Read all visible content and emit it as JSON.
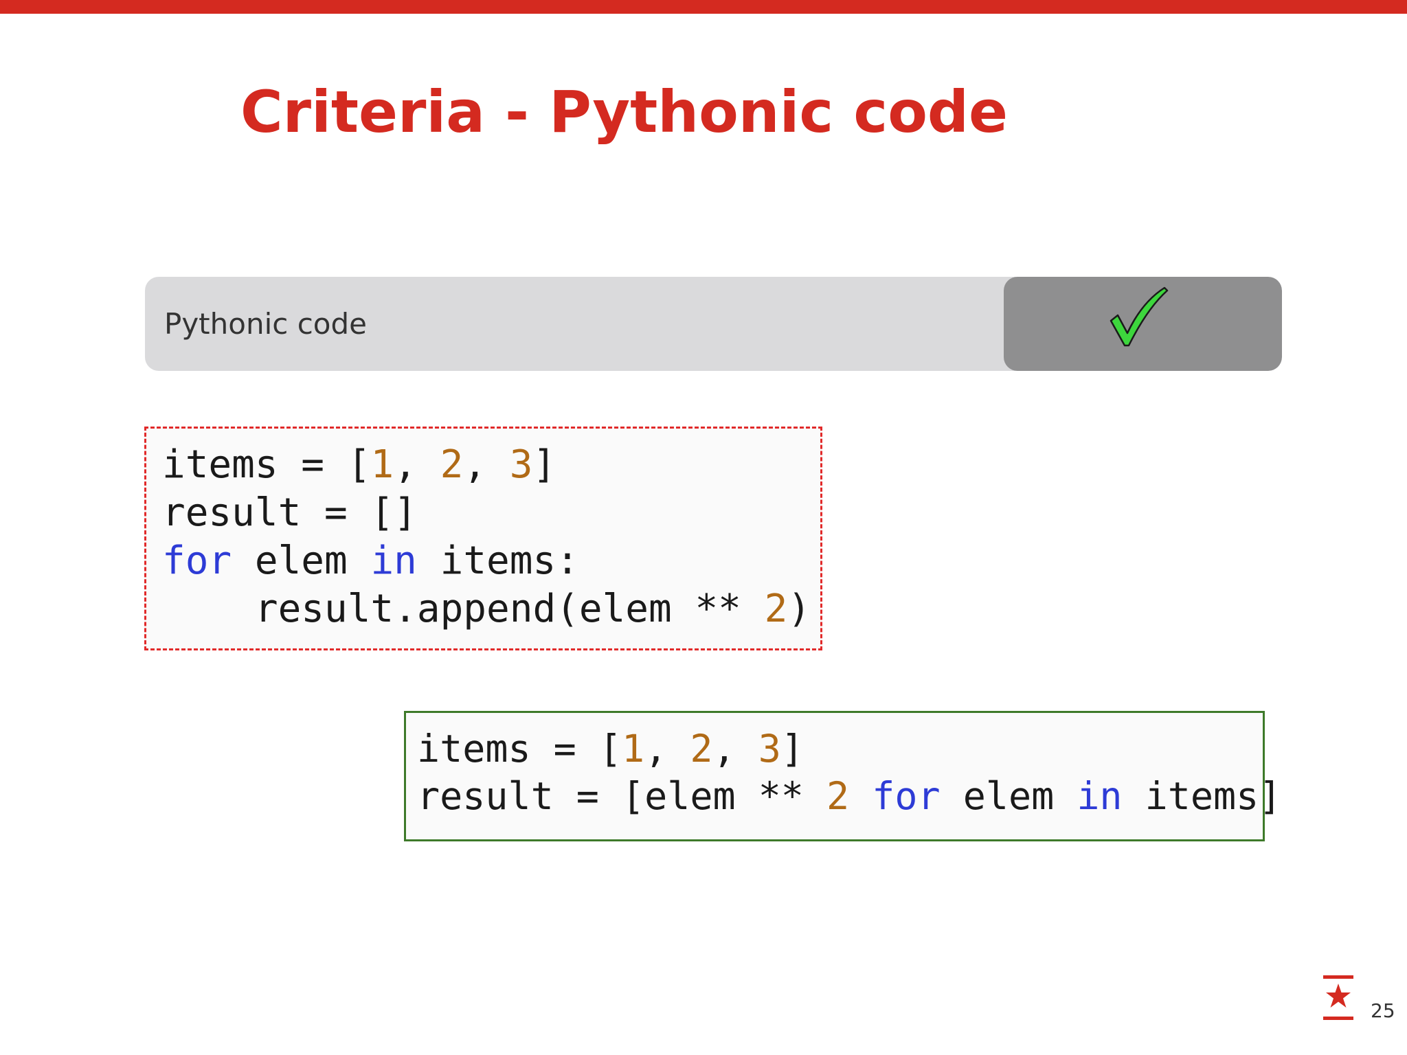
{
  "slide": {
    "title": "Criteria - Pythonic code",
    "page_number": "25"
  },
  "criteria": {
    "label": "Pythonic code",
    "status_icon": "check-icon",
    "status": "checked"
  },
  "code_bad": {
    "lines": [
      [
        {
          "t": "items = [",
          "k": "plain"
        },
        {
          "t": "1",
          "k": "num"
        },
        {
          "t": ", ",
          "k": "plain"
        },
        {
          "t": "2",
          "k": "num"
        },
        {
          "t": ", ",
          "k": "plain"
        },
        {
          "t": "3",
          "k": "num"
        },
        {
          "t": "]",
          "k": "plain"
        }
      ],
      [
        {
          "t": "result = []",
          "k": "plain"
        }
      ],
      [
        {
          "t": "for",
          "k": "kw"
        },
        {
          "t": " elem ",
          "k": "plain"
        },
        {
          "t": "in",
          "k": "kw"
        },
        {
          "t": " items:",
          "k": "plain"
        }
      ],
      [
        {
          "t": "    result.append(elem ** ",
          "k": "plain"
        },
        {
          "t": "2",
          "k": "num"
        },
        {
          "t": ")",
          "k": "plain"
        }
      ]
    ]
  },
  "code_good": {
    "lines": [
      [
        {
          "t": "items = [",
          "k": "plain"
        },
        {
          "t": "1",
          "k": "num"
        },
        {
          "t": ", ",
          "k": "plain"
        },
        {
          "t": "2",
          "k": "num"
        },
        {
          "t": ", ",
          "k": "plain"
        },
        {
          "t": "3",
          "k": "num"
        },
        {
          "t": "]",
          "k": "plain"
        }
      ],
      [
        {
          "t": "result = [elem ** ",
          "k": "plain"
        },
        {
          "t": "2",
          "k": "num"
        },
        {
          "t": " ",
          "k": "plain"
        },
        {
          "t": "for",
          "k": "kw"
        },
        {
          "t": " elem ",
          "k": "plain"
        },
        {
          "t": "in",
          "k": "kw"
        },
        {
          "t": " items]",
          "k": "plain"
        }
      ]
    ]
  },
  "colors": {
    "accent": "#d42a20",
    "criteria_bg": "#dadadc",
    "status_bg": "#8f8f90",
    "check": "#3dd63d",
    "bad_border": "#e12a2a",
    "good_border": "#3e7a2a",
    "code_number": "#b06a16",
    "code_keyword": "#2d3bd6"
  },
  "icons": {
    "logo": "star-logo-icon"
  }
}
